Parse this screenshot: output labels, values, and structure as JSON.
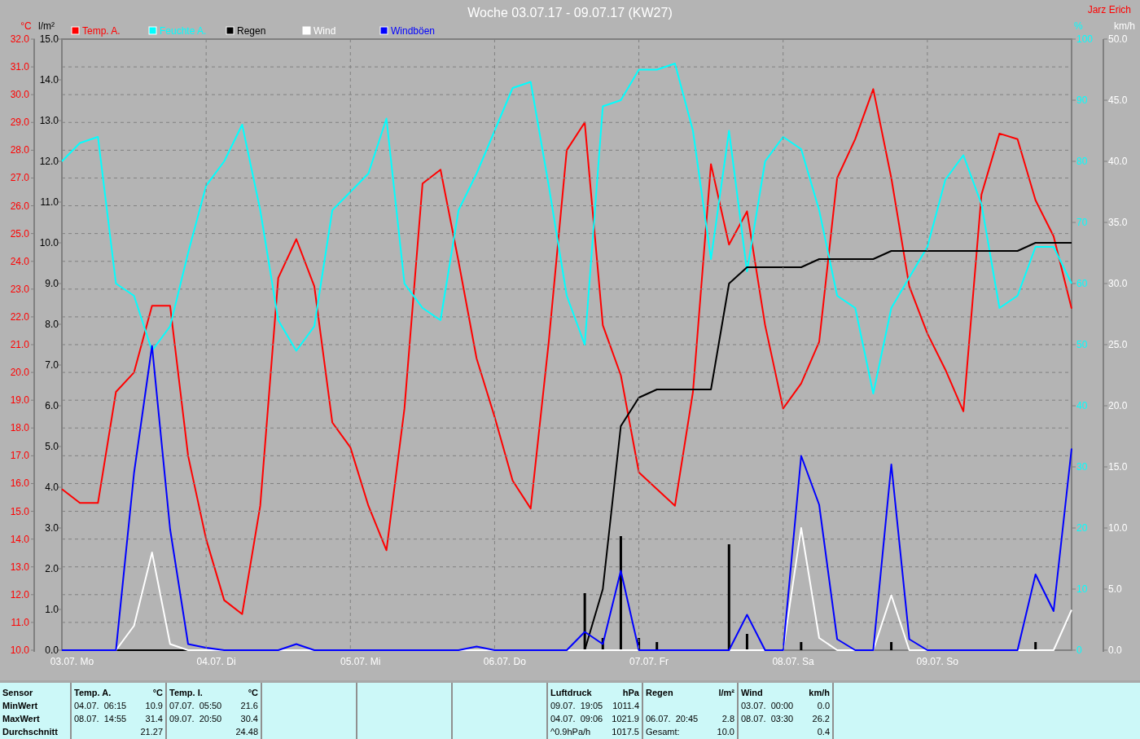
{
  "title": "Woche 03.07.17 - 09.07.17 (KW27)",
  "author": "Jarz Erich",
  "charts": [
    {
      "chart_data": {
        "type": "line",
        "ylabel": "°C",
        "xlim": [
          3,
          10
        ],
        "ylim": [
          10,
          32
        ],
        "yticks": [
          {
            "value": 32,
            "label": "32.0"
          },
          {
            "value": 31,
            "label": "31.0"
          },
          {
            "value": 30,
            "label": "30.0"
          },
          {
            "value": 29,
            "label": "29.0"
          },
          {
            "value": 28,
            "label": "28.0"
          },
          {
            "value": 27,
            "label": "27.0"
          },
          {
            "value": 26,
            "label": "26.0"
          },
          {
            "value": 25,
            "label": "25.0"
          },
          {
            "value": 24,
            "label": "24.0"
          },
          {
            "value": 23,
            "label": "23.0"
          },
          {
            "value": 22,
            "label": "22.0"
          },
          {
            "value": 21,
            "label": "21.0"
          },
          {
            "value": 20,
            "label": "20.0"
          },
          {
            "value": 19,
            "label": "19.0"
          },
          {
            "value": 18,
            "label": "18.0"
          },
          {
            "value": 17,
            "label": "17.0"
          },
          {
            "value": 16,
            "label": "16.0"
          },
          {
            "value": 15,
            "label": "15.0"
          },
          {
            "value": 14,
            "label": "14.0"
          },
          {
            "value": 13,
            "label": "13.0"
          },
          {
            "value": 12,
            "label": "12.0"
          },
          {
            "value": 11,
            "label": "11.0"
          },
          {
            "value": 10,
            "label": "10.0"
          }
        ],
        "x": [
          3,
          3.125,
          3.25,
          3.375,
          3.5,
          3.625,
          3.75,
          3.875,
          4,
          4.125,
          4.25,
          4.375,
          4.5,
          4.625,
          4.75,
          4.875,
          5,
          5.125,
          5.25,
          5.375,
          5.5,
          5.625,
          5.75,
          5.875,
          6,
          6.125,
          6.25,
          6.375,
          6.5,
          6.625,
          6.75,
          6.875,
          7,
          7.125,
          7.25,
          7.375,
          7.5,
          7.625,
          7.75,
          7.875,
          8,
          8.125,
          8.25,
          8.375,
          8.5,
          8.625,
          8.75,
          8.875,
          9,
          9.125,
          9.25,
          9.375,
          9.5,
          9.625,
          9.75,
          9.875,
          10
        ],
        "series": [
          {
            "name": "Temp. A.",
            "color": "#ff0000",
            "values": [
              15.8,
              15.3,
              15.3,
              19.3,
              20.0,
              22.4,
              22.4,
              17.0,
              14.0,
              11.8,
              11.3,
              15.2,
              23.4,
              24.8,
              23.1,
              18.2,
              17.3,
              15.2,
              13.6,
              18.7,
              26.8,
              27.3,
              24.0,
              20.5,
              18.4,
              16.1,
              15.1,
              21.1,
              28.0,
              29.0,
              21.7,
              19.9,
              16.4,
              15.8,
              15.2,
              19.3,
              27.5,
              24.6,
              25.8,
              21.7,
              18.7,
              19.6,
              21.1,
              27.0,
              28.4,
              30.2,
              27.0,
              23.1,
              21.4,
              20.1,
              18.6,
              26.4,
              28.6,
              28.4,
              26.2,
              24.9,
              22.3
            ]
          }
        ]
      }
    },
    {
      "chart_data": {
        "type": "line",
        "ylabel": "%",
        "xlim": [
          3,
          10
        ],
        "ylim": [
          0,
          100
        ],
        "yticks": [
          {
            "value": 100,
            "label": "100"
          },
          {
            "value": 90,
            "label": "90"
          },
          {
            "value": 80,
            "label": "80"
          },
          {
            "value": 70,
            "label": "70"
          },
          {
            "value": 60,
            "label": "60"
          },
          {
            "value": 50,
            "label": "50"
          },
          {
            "value": 40,
            "label": "40"
          },
          {
            "value": 30,
            "label": "30"
          },
          {
            "value": 20,
            "label": "20"
          },
          {
            "value": 10,
            "label": "10"
          },
          {
            "value": 0,
            "label": "0"
          }
        ],
        "x": [
          3,
          3.125,
          3.25,
          3.375,
          3.5,
          3.625,
          3.75,
          3.875,
          4,
          4.125,
          4.25,
          4.375,
          4.5,
          4.625,
          4.75,
          4.875,
          5,
          5.125,
          5.25,
          5.375,
          5.5,
          5.625,
          5.75,
          5.875,
          6,
          6.125,
          6.25,
          6.375,
          6.5,
          6.625,
          6.75,
          6.875,
          7,
          7.125,
          7.25,
          7.375,
          7.5,
          7.625,
          7.75,
          7.875,
          8,
          8.125,
          8.25,
          8.375,
          8.5,
          8.625,
          8.75,
          8.875,
          9,
          9.125,
          9.25,
          9.375,
          9.5,
          9.625,
          9.75,
          9.875,
          10
        ],
        "series": [
          {
            "name": "Feuchte A.",
            "color": "#00ffff",
            "values": [
              80,
              83,
              84,
              60,
              58,
              49,
              53,
              65,
              76,
              80,
              86,
              72,
              54,
              49,
              53,
              72,
              75,
              78,
              87,
              60,
              56,
              54,
              72,
              78,
              85,
              92,
              93,
              76,
              58,
              50,
              89,
              90,
              95,
              95,
              96,
              85,
              64,
              85,
              62,
              80,
              84,
              82,
              72,
              58,
              56,
              42,
              56,
              61,
              66,
              77,
              81,
              73,
              56,
              58,
              66,
              66,
              60
            ]
          }
        ]
      }
    },
    {
      "chart_data": {
        "type": "line",
        "ylabel": "l/m²",
        "xlim": [
          3,
          10
        ],
        "ylim": [
          0,
          15
        ],
        "yticks": [
          {
            "value": 15,
            "label": "15.0"
          },
          {
            "value": 14,
            "label": "14.0"
          },
          {
            "value": 13,
            "label": "13.0"
          },
          {
            "value": 12,
            "label": "12.0"
          },
          {
            "value": 11,
            "label": "11.0"
          },
          {
            "value": 10,
            "label": "10.0"
          },
          {
            "value": 9,
            "label": "9.0"
          },
          {
            "value": 8,
            "label": "8.0"
          },
          {
            "value": 7,
            "label": "7.0"
          },
          {
            "value": 6,
            "label": "6.0"
          },
          {
            "value": 5,
            "label": "5.0"
          },
          {
            "value": 4,
            "label": "4.0"
          },
          {
            "value": 3,
            "label": "3.0"
          },
          {
            "value": 2,
            "label": "2.0"
          },
          {
            "value": 1,
            "label": "1.0"
          },
          {
            "value": 0,
            "label": "0.0"
          }
        ],
        "x": [
          3.25,
          3.375,
          3.5,
          3.625,
          3.75,
          3.875,
          4,
          4.125,
          4.25,
          4.375,
          4.5,
          4.625,
          4.75,
          4.875,
          5,
          5.125,
          5.25,
          5.375,
          5.5,
          5.625,
          5.75,
          5.875,
          6,
          6.125,
          6.25,
          6.375,
          6.5,
          6.625,
          6.75,
          6.875,
          7,
          7.125,
          7.25,
          7.375,
          7.5,
          7.625,
          7.75,
          7.875,
          8,
          8.125,
          8.25,
          8.375,
          8.5,
          8.625,
          8.75,
          8.875,
          9,
          9.125,
          9.25,
          9.375,
          9.5,
          9.625,
          9.75,
          9.875,
          10
        ],
        "series": [
          {
            "name": "Regen",
            "color": "#000000",
            "values": [
              0,
              0,
              0,
              0,
              0,
              0,
              0,
              0,
              0,
              0,
              0,
              0,
              0,
              0,
              0,
              0,
              0,
              0,
              0,
              0,
              0,
              0,
              0,
              0,
              0,
              0,
              0,
              0,
              1.5,
              5.5,
              6.2,
              6.4,
              6.4,
              6.4,
              6.4,
              9.0,
              9.4,
              9.4,
              9.4,
              9.4,
              9.6,
              9.6,
              9.6,
              9.6,
              9.8,
              9.8,
              9.8,
              9.8,
              9.8,
              9.8,
              9.8,
              9.8,
              10.0,
              10.0,
              10.0
            ]
          }
        ]
      }
    },
    {
      "chart_data": {
        "type": "bar",
        "xlim": [
          3,
          10
        ],
        "ylim": [
          0,
          15
        ],
        "x": [
          3,
          3.125,
          3.25,
          3.375,
          3.5,
          3.625,
          3.75,
          3.875,
          4,
          4.125,
          4.25,
          4.375,
          4.5,
          4.625,
          4.75,
          4.875,
          5,
          5.125,
          5.25,
          5.375,
          5.5,
          5.625,
          5.75,
          5.875,
          6,
          6.125,
          6.25,
          6.375,
          6.5,
          6.625,
          6.75,
          6.875,
          7,
          7.125,
          7.25,
          7.375,
          7.5,
          7.625,
          7.75,
          7.875,
          8,
          8.125,
          8.25,
          8.375,
          8.5,
          8.625,
          8.75,
          8.875,
          9,
          9.125,
          9.25,
          9.375,
          9.5,
          9.625,
          9.75,
          9.875,
          10
        ],
        "series": [
          {
            "color": "#000000",
            "values": [
              0,
              0,
              0,
              0,
              0,
              0,
              0,
              0,
              0,
              0,
              0,
              0,
              0,
              0,
              0,
              0,
              0,
              0,
              0,
              0,
              0,
              0,
              0,
              0,
              0,
              0,
              0,
              0,
              0,
              1.4,
              0.3,
              2.8,
              0.3,
              0.2,
              0,
              0,
              0,
              2.6,
              0.4,
              0,
              0,
              0.2,
              0,
              0,
              0,
              0,
              0.2,
              0,
              0,
              0,
              0,
              0,
              0,
              0,
              0.2,
              0,
              0
            ]
          }
        ]
      }
    },
    {
      "chart_data": {
        "type": "line",
        "ylabel": "km/h",
        "xlim": [
          3,
          10
        ],
        "ylim": [
          0,
          50
        ],
        "xticks": [
          {
            "value": 3.07,
            "label": "03.07. Mo"
          },
          {
            "value": 4.07,
            "label": "04.07. Di"
          },
          {
            "value": 5.07,
            "label": "05.07. Mi"
          },
          {
            "value": 6.07,
            "label": "06.07. Do"
          },
          {
            "value": 7.07,
            "label": "07.07. Fr"
          },
          {
            "value": 8.07,
            "label": "08.07. Sa"
          },
          {
            "value": 9.07,
            "label": "09.07. So"
          }
        ],
        "yticks": [
          {
            "value": 50,
            "label": "50.0"
          },
          {
            "value": 45,
            "label": "45.0"
          },
          {
            "value": 40,
            "label": "40.0"
          },
          {
            "value": 35,
            "label": "35.0"
          },
          {
            "value": 30,
            "label": "30.0"
          },
          {
            "value": 25,
            "label": "25.0"
          },
          {
            "value": 20,
            "label": "20.0"
          },
          {
            "value": 15,
            "label": "15.0"
          },
          {
            "value": 10,
            "label": "10.0"
          },
          {
            "value": 5,
            "label": "5.0"
          },
          {
            "value": 0,
            "label": "0.0"
          }
        ],
        "x": [
          3,
          3.125,
          3.25,
          3.375,
          3.5,
          3.625,
          3.75,
          3.875,
          4,
          4.125,
          4.25,
          4.375,
          4.5,
          4.625,
          4.75,
          4.875,
          5,
          5.125,
          5.25,
          5.375,
          5.5,
          5.625,
          5.75,
          5.875,
          6,
          6.125,
          6.25,
          6.375,
          6.5,
          6.625,
          6.75,
          6.875,
          7,
          7.125,
          7.25,
          7.375,
          7.5,
          7.625,
          7.75,
          7.875,
          8,
          8.125,
          8.25,
          8.375,
          8.5,
          8.625,
          8.75,
          8.875,
          9,
          9.125,
          9.25,
          9.375,
          9.5,
          9.625,
          9.75,
          9.875,
          10
        ],
        "series": [
          {
            "name": "Wind",
            "color": "#ffffff",
            "values": [
              null,
              null,
              0,
              0,
              2,
              8,
              0.5,
              0,
              0,
              0,
              0,
              0,
              0,
              0,
              0,
              0,
              0,
              0,
              0,
              0,
              0,
              0,
              0,
              0,
              0,
              0,
              0,
              0,
              0,
              0,
              0,
              0,
              0,
              0,
              0,
              0,
              0,
              0,
              0,
              0,
              0,
              10,
              1,
              0,
              0,
              0,
              4.5,
              0,
              0,
              0,
              0,
              0,
              0,
              0,
              0,
              0,
              3.3
            ]
          },
          {
            "name": "Windböen",
            "color": "#0000ff",
            "values": [
              0,
              0,
              0,
              0,
              14.5,
              24.9,
              9.9,
              0.5,
              0.2,
              0,
              0,
              0,
              0,
              0.5,
              0,
              0,
              0,
              0,
              0,
              0,
              0,
              0,
              0,
              0.3,
              0,
              0,
              0,
              0,
              0,
              1.5,
              0.5,
              6.5,
              0,
              0,
              0,
              0,
              0,
              0,
              2.9,
              0,
              0,
              15.9,
              11.9,
              0.9,
              0,
              0,
              15.2,
              0.9,
              0,
              0,
              0,
              0,
              0,
              0,
              6.2,
              3.2,
              16.5
            ]
          }
        ]
      }
    }
  ],
  "stats": {
    "row_labels": [
      "Sensor",
      "MinWert",
      "MaxWert",
      "Durchschnitt"
    ],
    "columns": [
      {
        "kind": "data",
        "header": "Temp. A.",
        "unit": "°C",
        "cells": [
          {
            "time": "04.07.  06:15",
            "value": "10.9"
          },
          {
            "time": "08.07.  14:55",
            "value": "31.4"
          },
          {
            "value": "21.27"
          }
        ]
      },
      {
        "kind": "data",
        "header": "Temp. I.",
        "unit": "°C",
        "cells": [
          {
            "time": "07.07.  05:50",
            "value": "21.6"
          },
          {
            "time": "09.07.  20:50",
            "value": "30.4"
          },
          {
            "value": "24.48"
          }
        ]
      },
      {
        "kind": "empty"
      },
      {
        "kind": "empty"
      },
      {
        "kind": "empty"
      },
      {
        "kind": "data",
        "header": "Luftdruck",
        "unit": "hPa",
        "cells": [
          {
            "time": "09.07.  19:05",
            "value": "1011.4"
          },
          {
            "time": "04.07.  09:06",
            "value": "1021.9"
          },
          {
            "time": "^0.9hPa/h",
            "value": "1017.5"
          }
        ]
      },
      {
        "kind": "data",
        "header": "Regen",
        "unit": "l/m²",
        "cells": [
          {},
          {
            "time": "06.07.  20:45",
            "value": "2.8"
          },
          {
            "time": "Gesamt:",
            "value": "10.0"
          }
        ]
      },
      {
        "kind": "data",
        "header": "Wind",
        "unit": "km/h",
        "cells": [
          {
            "time": "03.07.  00:00",
            "value": "0.0"
          },
          {
            "time": "08.07.  03:30",
            "value": "26.2"
          },
          {
            "value": "0.4"
          }
        ]
      }
    ]
  }
}
